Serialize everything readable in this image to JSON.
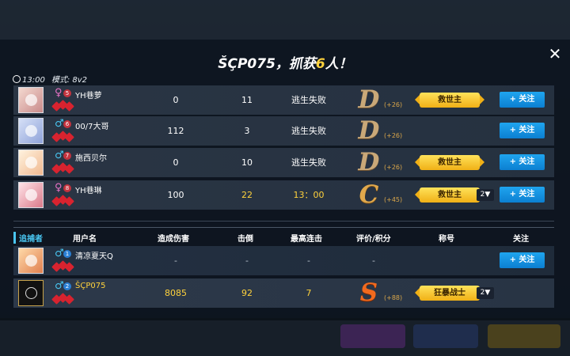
{
  "title": {
    "prefix": "ŠÇP075，抓获",
    "count": "6",
    "suffix": "人！"
  },
  "info": {
    "time": "13:00",
    "mode": "模式: 8v2"
  },
  "close_label": "✕",
  "follow_label": "+ 关注",
  "headers": {
    "role": "追捕者",
    "username": "用户名",
    "damage": "造成伤害",
    "kills": "击倒",
    "combo": "最高连击",
    "rating": "评价/积分",
    "honor": "称号",
    "follow": "关注"
  },
  "escapees": [
    {
      "gender": "♀",
      "level": "5",
      "name": "YH巷萝",
      "damage": "0",
      "kills": "11",
      "result": "逃生失败",
      "grade": "D",
      "score": "(+26)",
      "honor": "救世主",
      "honor_count": "",
      "follow": true
    },
    {
      "gender": "♂",
      "level": "6",
      "name": "00/7大哥",
      "damage": "112",
      "kills": "3",
      "result": "逃生失败",
      "grade": "D",
      "score": "(+26)",
      "honor": "",
      "honor_count": "",
      "follow": true
    },
    {
      "gender": "♂",
      "level": "7",
      "name": "施西贝尔",
      "damage": "0",
      "kills": "10",
      "result": "逃生失败",
      "grade": "D",
      "score": "(+26)",
      "honor": "救世主",
      "honor_count": "",
      "follow": true
    },
    {
      "gender": "♀",
      "level": "8",
      "name": "YH巷琳",
      "damage": "100",
      "kills": "22",
      "result": "13：00",
      "grade": "C",
      "score": "(+45)",
      "honor": "救世主",
      "honor_count": "2▼",
      "follow": true
    }
  ],
  "hunters": [
    {
      "gender": "♂",
      "level": "1",
      "name": "清凉夏天Q",
      "damage": "-",
      "kills": "-",
      "combo": "-",
      "grade": "",
      "score": "-",
      "honor": "",
      "honor_count": "",
      "follow": true
    },
    {
      "gender": "♂",
      "level": "2",
      "name": "ŠÇP075",
      "damage": "8085",
      "kills": "92",
      "combo": "7",
      "grade": "S",
      "score": "(+88)",
      "honor": "狂暴战士",
      "honor_count": "2▼",
      "follow": false
    }
  ],
  "colors": {
    "accent_blue": "#1fa5ef",
    "gold": "#ffd23c",
    "female": "#e873c7",
    "male": "#49c5f0"
  }
}
